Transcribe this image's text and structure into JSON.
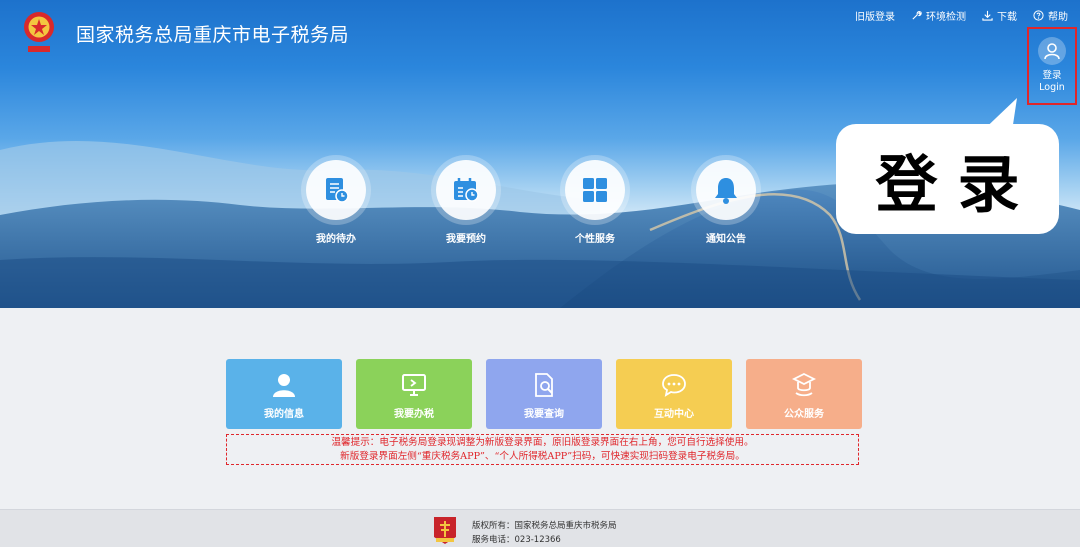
{
  "header": {
    "title": "国家税务总局重庆市电子税务局",
    "nav": [
      {
        "label": "旧版登录",
        "icon": "none"
      },
      {
        "label": "环境检测",
        "icon": "wrench-icon"
      },
      {
        "label": "下载",
        "icon": "download-icon"
      },
      {
        "label": "帮助",
        "icon": "help-icon"
      }
    ],
    "login": {
      "line1": "登录",
      "line2": "Login"
    }
  },
  "callout": {
    "text": "登录"
  },
  "hero_icons": [
    {
      "label": "我的待办",
      "icon": "todo-icon"
    },
    {
      "label": "我要预约",
      "icon": "calendar-icon"
    },
    {
      "label": "个性服务",
      "icon": "grid-icon"
    },
    {
      "label": "通知公告",
      "icon": "bell-icon"
    }
  ],
  "cards": [
    {
      "label": "我的信息",
      "icon": "person-icon",
      "color": "#5ab2e9"
    },
    {
      "label": "我要办税",
      "icon": "monitor-icon",
      "color": "#8bd25a"
    },
    {
      "label": "我要查询",
      "icon": "document-search-icon",
      "color": "#8fa6ee"
    },
    {
      "label": "互动中心",
      "icon": "chat-icon",
      "color": "#f5cd52"
    },
    {
      "label": "公众服务",
      "icon": "service-icon",
      "color": "#f6ae8a"
    }
  ],
  "notice": {
    "line1": "温馨提示：电子税务局登录现调整为新版登录界面，原旧版登录界面在右上角，您可自行选择使用。",
    "line2": "新版登录界面左侧“重庆税务APP”、“个人所得税APP”扫码，可快速实现扫码登录电子税务局。"
  },
  "footer": {
    "copyright": "版权所有：国家税务总局重庆市税务局",
    "phone": "服务电话：023-12366"
  },
  "colors": {
    "accent_red": "#e0262b",
    "hero_blue": "#2b86dc"
  }
}
